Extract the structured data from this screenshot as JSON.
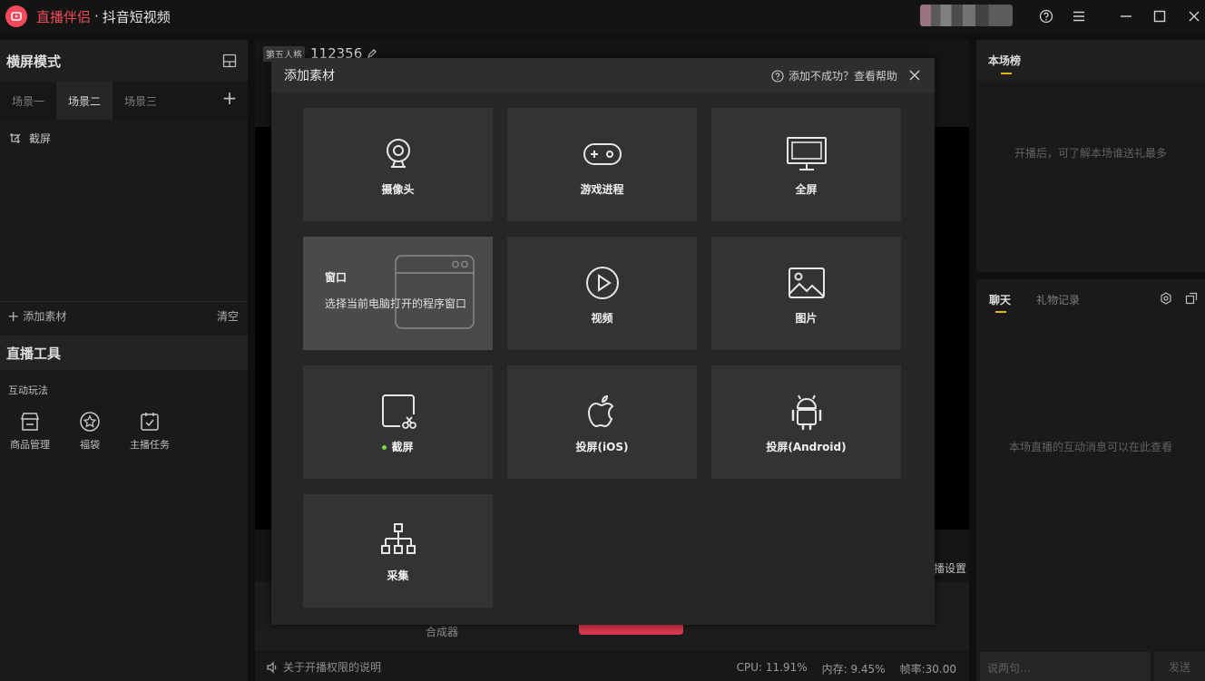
{
  "titlebar": {
    "app_name": "直播伴侣",
    "separator": "·",
    "app_sub": "抖音短视频"
  },
  "left": {
    "mode_title": "横屏模式",
    "tabs": [
      "场景一",
      "场景二",
      "场景三"
    ],
    "active_tab": 1,
    "sources": [
      "截屏"
    ],
    "add_source": "添加素材",
    "clear": "清空",
    "tools_title": "直播工具",
    "tools_subtitle": "互动玩法",
    "tools": [
      {
        "label": "商品管理",
        "icon": "shop-icon"
      },
      {
        "label": "福袋",
        "icon": "star-badge-icon"
      },
      {
        "label": "主播任务",
        "icon": "task-calendar-icon"
      }
    ]
  },
  "center": {
    "room_badge": "第五人格",
    "room_id": "112356",
    "settings_label": "播设置",
    "compositor": "合成器",
    "notice": "关于开播权限的说明",
    "stats": {
      "cpu": "CPU: 11.91%",
      "mem": "内存: 9.45%",
      "fps": "帧率:30.00"
    }
  },
  "right": {
    "rank_title": "本场榜",
    "rank_empty": "开播后，可了解本场谁送礼最多",
    "chat_tabs": [
      "聊天",
      "礼物记录"
    ],
    "chat_empty": "本场直播的互动消息可以在此查看",
    "chat_placeholder": "说两句...",
    "send": "发送"
  },
  "modal": {
    "title": "添加素材",
    "help": "添加不成功？查看帮助",
    "cards": [
      {
        "label": "摄像头",
        "icon": "camera-icon"
      },
      {
        "label": "游戏进程",
        "icon": "gamepad-icon"
      },
      {
        "label": "全屏",
        "icon": "monitor-icon"
      },
      {
        "label": "窗口",
        "desc": "选择当前电脑打开的程序窗口",
        "icon": "window-icon"
      },
      {
        "label": "视频",
        "icon": "play-icon"
      },
      {
        "label": "图片",
        "icon": "image-icon"
      },
      {
        "label": "截屏",
        "icon": "screenshot-icon"
      },
      {
        "label": "投屏(iOS)",
        "icon": "apple-icon"
      },
      {
        "label": "投屏(Android)",
        "icon": "android-icon"
      },
      {
        "label": "采集",
        "icon": "capture-network-icon"
      }
    ]
  },
  "colors": {
    "accent": "#f04b59",
    "tab_underline": "#f5c518",
    "active_dot": "#7bd34a"
  }
}
